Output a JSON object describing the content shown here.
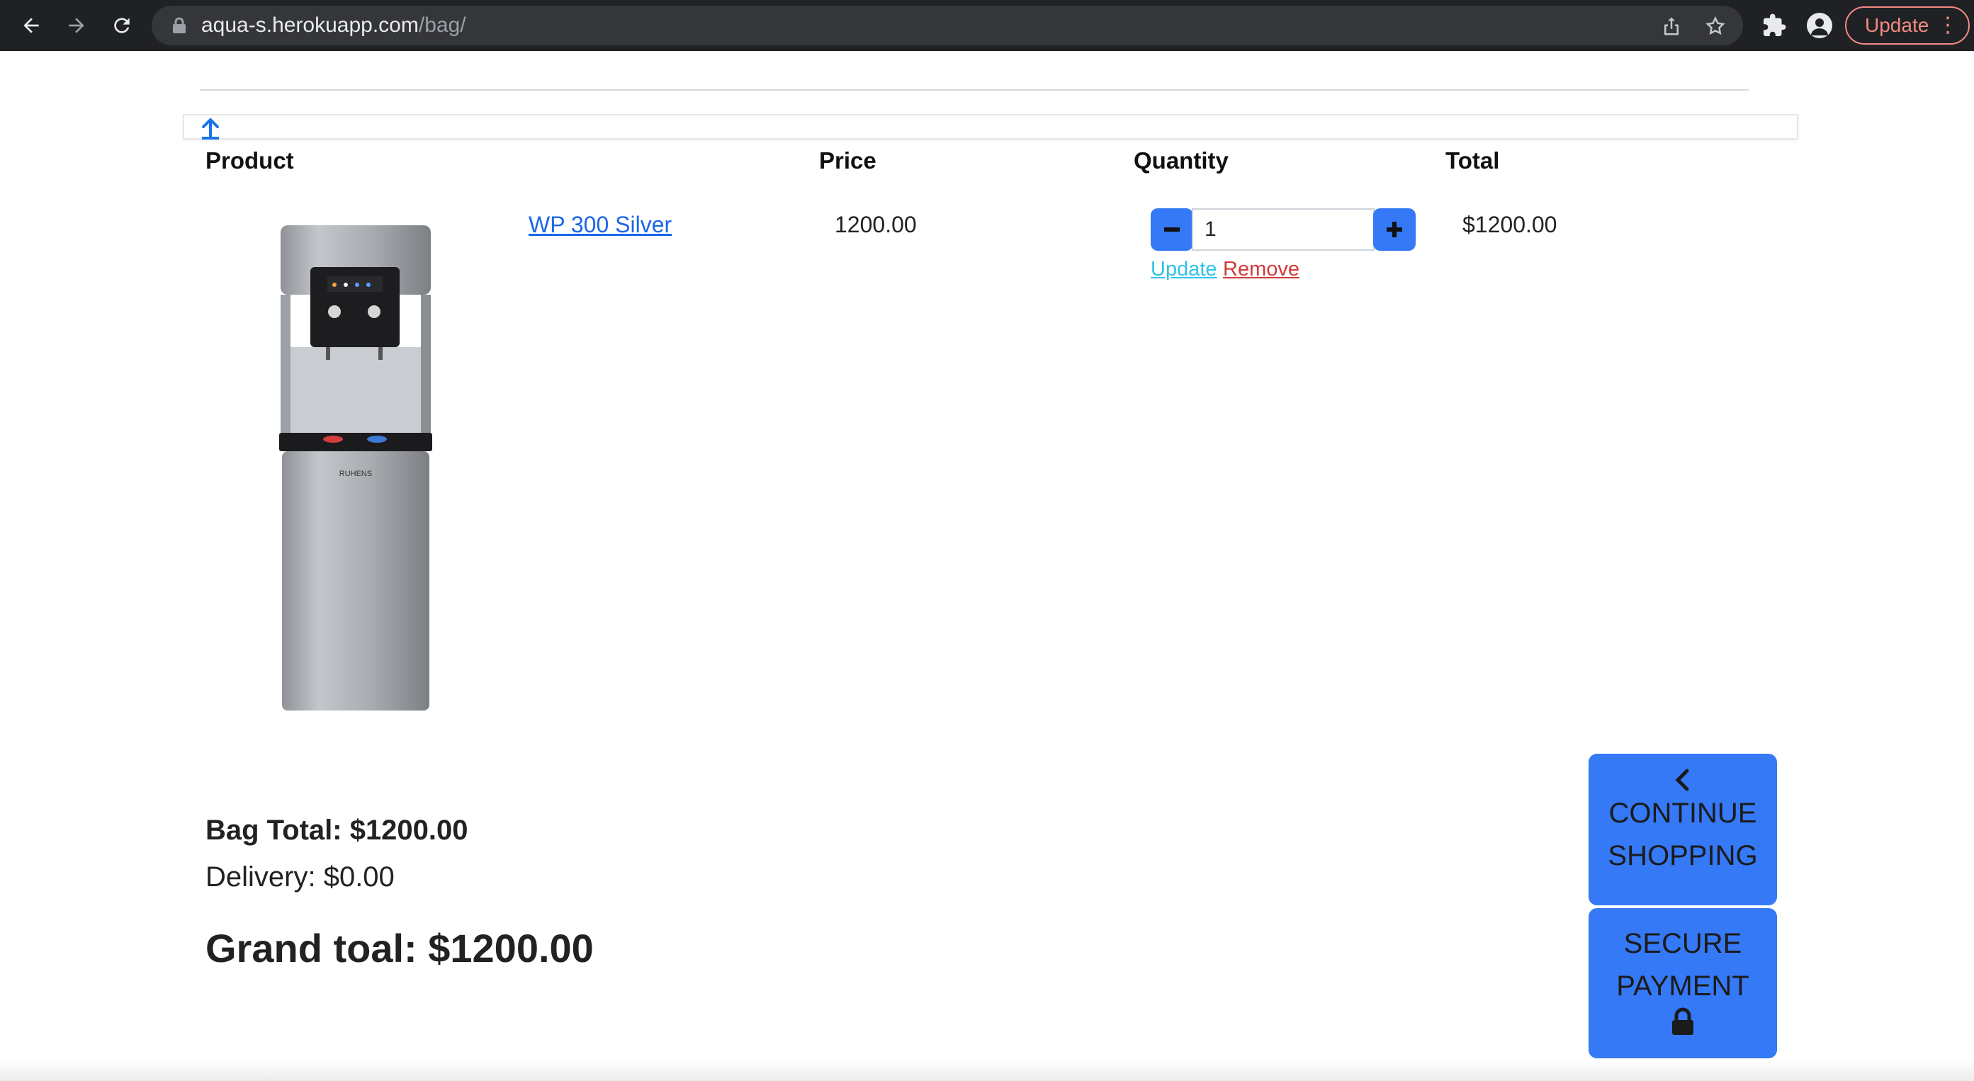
{
  "browser": {
    "url_host": "aqua-s.herokuapp.com",
    "url_path": "/bag/",
    "update_label": "Update",
    "menu_icon": "kebab-menu-icon"
  },
  "table": {
    "headers": [
      "Product",
      "Price",
      "Quantity",
      "Total"
    ],
    "row": {
      "product_name": "WP 300 Silver",
      "image_brand_mark": "RUHENS",
      "price": "1200.00",
      "quantity": "1",
      "total": "$1200.00",
      "update_label": "Update",
      "remove_label": "Remove"
    }
  },
  "summary": {
    "bag_total": "Bag Total: $1200.00",
    "delivery": "Delivery: $0.00",
    "grand_total": "Grand toal: $1200.00"
  },
  "buttons": {
    "continue_line1": "CONTINUE",
    "continue_line2": "SHOPPING",
    "secure_line1": "SECURE",
    "secure_line2": "PAYMENT"
  },
  "colors": {
    "primary_button": "#3579f6",
    "link": "#1a66e8",
    "update_link": "#2ec3e6",
    "remove_link": "#d13a3a",
    "chrome_bg": "#202124",
    "chrome_update": "#f28b82"
  }
}
